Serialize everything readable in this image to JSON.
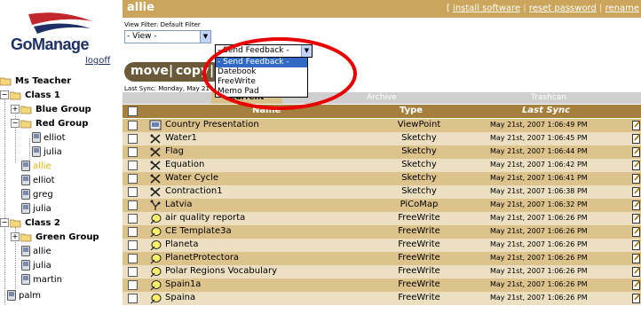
{
  "brand": {
    "name": "GoManage",
    "logoff": "logoff"
  },
  "colors": {
    "topbar": "#cba55c",
    "header": "#a57f3e",
    "row_odd": "#dcc28b",
    "row_even": "#ecdfc2",
    "accent": "#e2b400",
    "circle": "#e80000"
  },
  "tree": {
    "root": "Ms Teacher",
    "class1": "Class 1",
    "blue_group": "Blue Group",
    "red_group": "Red Group",
    "red_members": [
      "elliot",
      "julia"
    ],
    "class1_students": [
      "allie",
      "elliot",
      "greg",
      "julia"
    ],
    "class2": "Class 2",
    "green_group": "Green Group",
    "class2_students": [
      "allie",
      "julia",
      "martin"
    ],
    "palm": "palm"
  },
  "header": {
    "user": "allie",
    "links": [
      "install software",
      "reset password",
      "rename"
    ],
    "separator": "|",
    "bracket_open": "[",
    "bracket_close": "]"
  },
  "filter": {
    "label": "View Filter: Default Filter",
    "view_value": "- View -",
    "feedback_value": "- Send Feedback -",
    "dropdown_options": [
      "- Send Feedback -",
      "Datebook",
      "FreeWrite",
      "Memo Pad"
    ],
    "dropdown_selected": "- Send Feedback -"
  },
  "actions": {
    "move": "move",
    "sep": "|",
    "copy": "copy",
    "more": "s"
  },
  "sync_text": "Last Sync: Monday, May 21",
  "tabs": {
    "current": "Current",
    "archive": "Archive",
    "trashcan": "Trashcan"
  },
  "columns": {
    "name": "Name",
    "type": "Type",
    "last_sync": "Last Sync"
  },
  "rows": [
    {
      "name": "Country Presentation",
      "type": "ViewPoint",
      "sync": "May 21st, 2007 1:06:49 PM",
      "icon": "viewpoint-icon"
    },
    {
      "name": "Water1",
      "type": "Sketchy",
      "sync": "May 21st, 2007 1:06:45 PM",
      "icon": "sketchy-icon"
    },
    {
      "name": "Flag",
      "type": "Sketchy",
      "sync": "May 21st, 2007 1:06:44 PM",
      "icon": "sketchy-icon"
    },
    {
      "name": "Equation",
      "type": "Sketchy",
      "sync": "May 21st, 2007 1:06:42 PM",
      "icon": "sketchy-icon"
    },
    {
      "name": "Water Cycle",
      "type": "Sketchy",
      "sync": "May 21st, 2007 1:06:41 PM",
      "icon": "sketchy-icon"
    },
    {
      "name": "Contraction1",
      "type": "Sketchy",
      "sync": "May 21st, 2007 1:06:38 PM",
      "icon": "sketchy-icon"
    },
    {
      "name": "Latvia",
      "type": "PiCoMap",
      "sync": "May 21st, 2007 1:06:32 PM",
      "icon": "picomap-icon"
    },
    {
      "name": "air quality reporta",
      "type": "FreeWrite",
      "sync": "May 21st, 2007 1:06:26 PM",
      "icon": "freewrite-icon"
    },
    {
      "name": "CE Template3a",
      "type": "FreeWrite",
      "sync": "May 21st, 2007 1:06:26 PM",
      "icon": "freewrite-icon"
    },
    {
      "name": "Planeta",
      "type": "FreeWrite",
      "sync": "May 21st, 2007 1:06:26 PM",
      "icon": "freewrite-icon"
    },
    {
      "name": "PlanetProtectora",
      "type": "FreeWrite",
      "sync": "May 21st, 2007 1:06:26 PM",
      "icon": "freewrite-icon"
    },
    {
      "name": "Polar Regions Vocabulary",
      "type": "FreeWrite",
      "sync": "May 21st, 2007 1:06:26 PM",
      "icon": "freewrite-icon"
    },
    {
      "name": "Spain1a",
      "type": "FreeWrite",
      "sync": "May 21st, 2007 1:06:26 PM",
      "icon": "freewrite-icon"
    },
    {
      "name": "Spaina",
      "type": "FreeWrite",
      "sync": "May 21st, 2007 1:06:26 PM",
      "icon": "freewrite-icon"
    }
  ]
}
